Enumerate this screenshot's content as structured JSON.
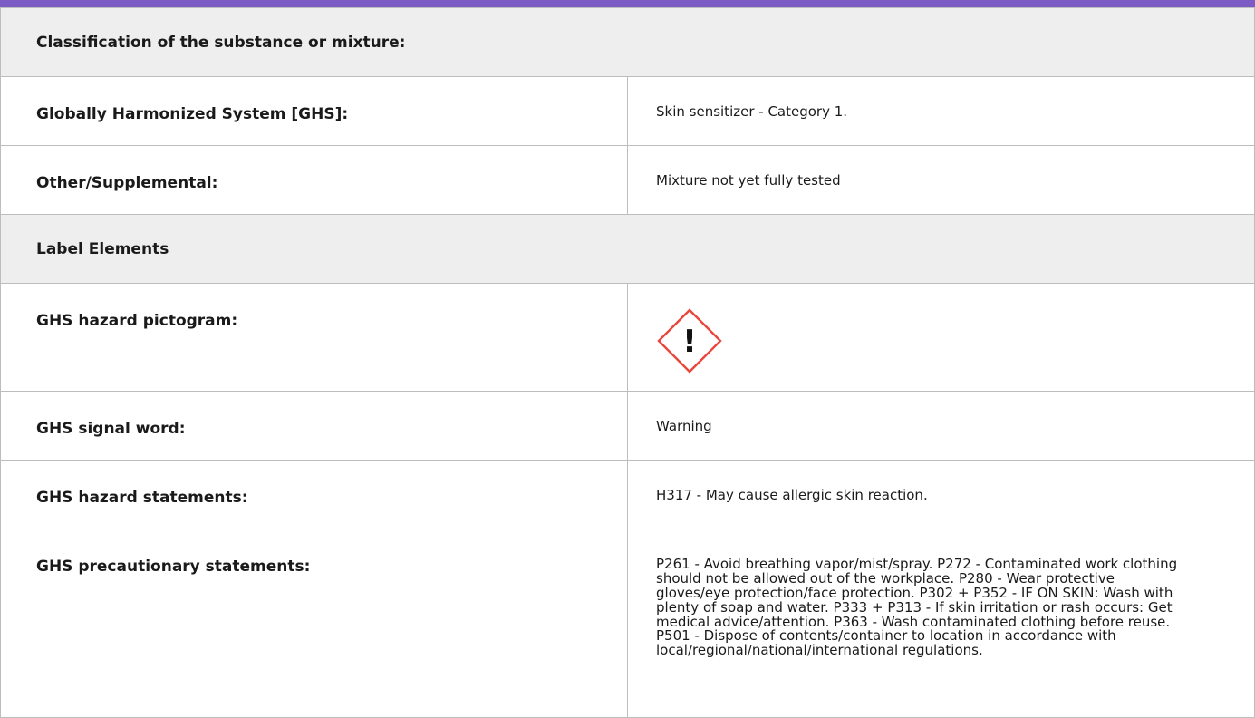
{
  "theme": {
    "accent": "#7c5cc4",
    "hazard_red": "#e8473c"
  },
  "classification_header": "Classification of the substance or mixture:",
  "rows_classification": [
    {
      "label": "Globally Harmonized System [GHS]:",
      "value": "Skin sensitizer - Category 1."
    },
    {
      "label": "Other/Supplemental:",
      "value": "Mixture not yet fully tested"
    }
  ],
  "label_elements_header": "Label Elements",
  "pictogram_row": {
    "label": "GHS hazard pictogram:",
    "icon": "exclamation-mark-hazard-icon",
    "symbol": "!"
  },
  "signal_row": {
    "label": "GHS signal word:",
    "value": "Warning"
  },
  "hazard_row": {
    "label": "GHS hazard statements:",
    "value": "H317 - May cause allergic skin reaction."
  },
  "precautionary_row": {
    "label": "GHS precautionary statements:",
    "value": "P261 - Avoid breathing vapor/mist/spray. P272 - Contaminated work clothing should not be allowed out of the workplace. P280 - Wear protective gloves/eye protection/face protection. P302 + P352 - IF ON SKIN: Wash with plenty of soap and water. P333 + P313 - If skin irritation or rash occurs: Get medical advice/attention. P363 - Wash contaminated clothing before reuse. P501 - Dispose of contents/container to location in accordance with local/regional/national/international regulations."
  }
}
